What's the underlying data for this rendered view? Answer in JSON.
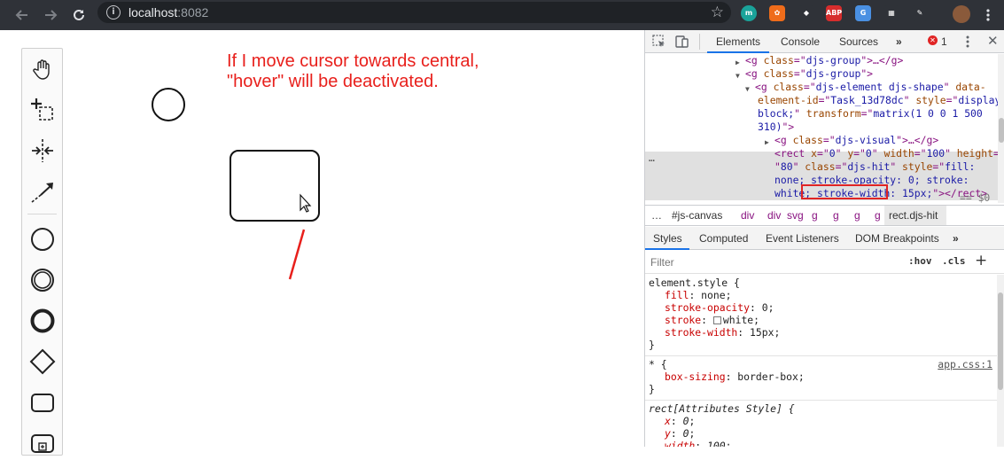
{
  "browser": {
    "url_host": "localhost",
    "url_port": ":8082",
    "info_icon": "info-icon",
    "extensions": [
      {
        "name": "m-extension-icon",
        "label": "m",
        "color": "#1aa39a"
      },
      {
        "name": "orange-extension-icon",
        "label": "✿",
        "color": "#ef6c1a"
      },
      {
        "name": "diamond-extension-icon",
        "label": "◆",
        "color": "#2f3238"
      },
      {
        "name": "abp-extension-icon",
        "label": "ABP",
        "color": "#d62d2d"
      },
      {
        "name": "translate-extension-icon",
        "label": "G",
        "color": "#4a90e2"
      },
      {
        "name": "grid-extension-icon",
        "label": "▦",
        "color": "#2f3238"
      },
      {
        "name": "feather-extension-icon",
        "label": "✎",
        "color": "#2f3238"
      },
      {
        "name": "profile-avatar-icon",
        "label": "",
        "color": "#8a5a3b"
      }
    ]
  },
  "canvas": {
    "note_text": "If I move cursor towards central,\n\"hover\" will be deactivated.",
    "palette": [
      {
        "name": "hand-tool-icon"
      },
      {
        "name": "lasso-tool-icon"
      },
      {
        "name": "space-tool-icon"
      },
      {
        "name": "global-connect-tool-icon"
      },
      {
        "name": "start-event-icon"
      },
      {
        "name": "intermediate-event-icon"
      },
      {
        "name": "end-event-icon"
      },
      {
        "name": "gateway-icon"
      },
      {
        "name": "task-icon"
      },
      {
        "name": "subprocess-icon"
      }
    ]
  },
  "devtools": {
    "tabs": [
      "Elements",
      "Console",
      "Sources"
    ],
    "more_tabs": "»",
    "error_count": "1",
    "dom_lines": [
      {
        "indent": 0,
        "arrow": "▶",
        "parts": [
          [
            "tagc",
            "<g "
          ],
          [
            "attrn",
            "class"
          ],
          [
            "tagc",
            "=\""
          ],
          [
            "attrv",
            "djs-group"
          ],
          [
            "tagc",
            "\">…</g>"
          ]
        ]
      },
      {
        "indent": 0,
        "arrow": "▼",
        "parts": [
          [
            "tagc",
            "<g "
          ],
          [
            "attrn",
            "class"
          ],
          [
            "tagc",
            "=\""
          ],
          [
            "attrv",
            "djs-group"
          ],
          [
            "tagc",
            "\">"
          ]
        ]
      },
      {
        "indent": 1,
        "arrow": "▼",
        "parts": [
          [
            "tagc",
            "<g "
          ],
          [
            "attrn",
            "class"
          ],
          [
            "tagc",
            "=\""
          ],
          [
            "attrv",
            "djs-element djs-shape"
          ],
          [
            "tagc",
            "\" "
          ],
          [
            "attrn",
            "data-"
          ]
        ]
      },
      {
        "indent": 2,
        "arrow": "",
        "parts": [
          [
            "attrn",
            "element-id"
          ],
          [
            "tagc",
            "=\""
          ],
          [
            "attrv",
            "Task_13d78dc"
          ],
          [
            "tagc",
            "\" "
          ],
          [
            "attrn",
            "style"
          ],
          [
            "tagc",
            "=\""
          ],
          [
            "attrv",
            "display:"
          ]
        ]
      },
      {
        "indent": 2,
        "arrow": "",
        "parts": [
          [
            "attrv",
            "block;"
          ],
          [
            "tagc",
            "\" "
          ],
          [
            "attrn",
            "transform"
          ],
          [
            "tagc",
            "=\""
          ],
          [
            "attrv",
            "matrix(1 0 0 1 500"
          ]
        ]
      },
      {
        "indent": 2,
        "arrow": "",
        "parts": [
          [
            "attrv",
            "310)"
          ],
          [
            "tagc",
            "\">"
          ]
        ]
      },
      {
        "indent": 3,
        "arrow": "▶",
        "parts": [
          [
            "tagc",
            "<g "
          ],
          [
            "attrn",
            "class"
          ],
          [
            "tagc",
            "=\""
          ],
          [
            "attrv",
            "djs-visual"
          ],
          [
            "tagc",
            "\">…</g>"
          ]
        ]
      },
      {
        "indent": 3,
        "arrow": "",
        "parts": [
          [
            "tagc",
            "<rect "
          ],
          [
            "attrn",
            "x"
          ],
          [
            "tagc",
            "=\""
          ],
          [
            "attrv",
            "0"
          ],
          [
            "tagc",
            "\" "
          ],
          [
            "attrn",
            "y"
          ],
          [
            "tagc",
            "=\""
          ],
          [
            "attrv",
            "0"
          ],
          [
            "tagc",
            "\" "
          ],
          [
            "attrn",
            "width"
          ],
          [
            "tagc",
            "=\""
          ],
          [
            "attrv",
            "100"
          ],
          [
            "tagc",
            "\" "
          ],
          [
            "attrn",
            "height"
          ],
          [
            "tagc",
            "="
          ]
        ]
      },
      {
        "indent": 3,
        "arrow": "",
        "parts": [
          [
            "tagc",
            "\""
          ],
          [
            "attrv",
            "80"
          ],
          [
            "tagc",
            "\" "
          ],
          [
            "attrn",
            "class"
          ],
          [
            "tagc",
            "=\""
          ],
          [
            "attrv",
            "djs-hit"
          ],
          [
            "tagc",
            "\" "
          ],
          [
            "attrn",
            "style"
          ],
          [
            "tagc",
            "=\""
          ],
          [
            "attrv",
            "fill:"
          ]
        ]
      },
      {
        "indent": 3,
        "arrow": "",
        "parts": [
          [
            "attrv",
            "none; stroke-opacity: 0; stroke:"
          ]
        ]
      },
      {
        "indent": 3,
        "arrow": "",
        "parts": [
          [
            "attrv",
            "white; stroke-width: 15px;"
          ],
          [
            "tagc",
            "\"></rect>"
          ]
        ]
      }
    ],
    "selected_suffix": "== $0",
    "ellipsis": "…",
    "breadcrumbs": [
      "…",
      "#js-canvas",
      "div",
      "div",
      "svg",
      "g",
      "g",
      "g",
      "g",
      "rect.djs-hit"
    ],
    "subtabs": [
      "Styles",
      "Computed",
      "Event Listeners",
      "DOM Breakpoints"
    ],
    "subtabs_more": "»",
    "filter_placeholder": "Filter",
    "hov": ":hov",
    "cls": ".cls",
    "plus": "+",
    "rules": [
      {
        "selector": "element.style {",
        "source": "",
        "props": [
          [
            "fill",
            "none"
          ],
          [
            "stroke-opacity",
            "0"
          ],
          [
            "stroke",
            "white"
          ],
          [
            "stroke-width",
            "15px"
          ]
        ]
      },
      {
        "selector": "* {",
        "source": "app.css:1",
        "props": [
          [
            "box-sizing",
            "border-box"
          ]
        ]
      },
      {
        "selector": "rect[Attributes Style] {",
        "source": "",
        "props": [
          [
            "x",
            "0"
          ],
          [
            "y",
            "0"
          ],
          [
            "width",
            "100"
          ]
        ]
      }
    ]
  }
}
